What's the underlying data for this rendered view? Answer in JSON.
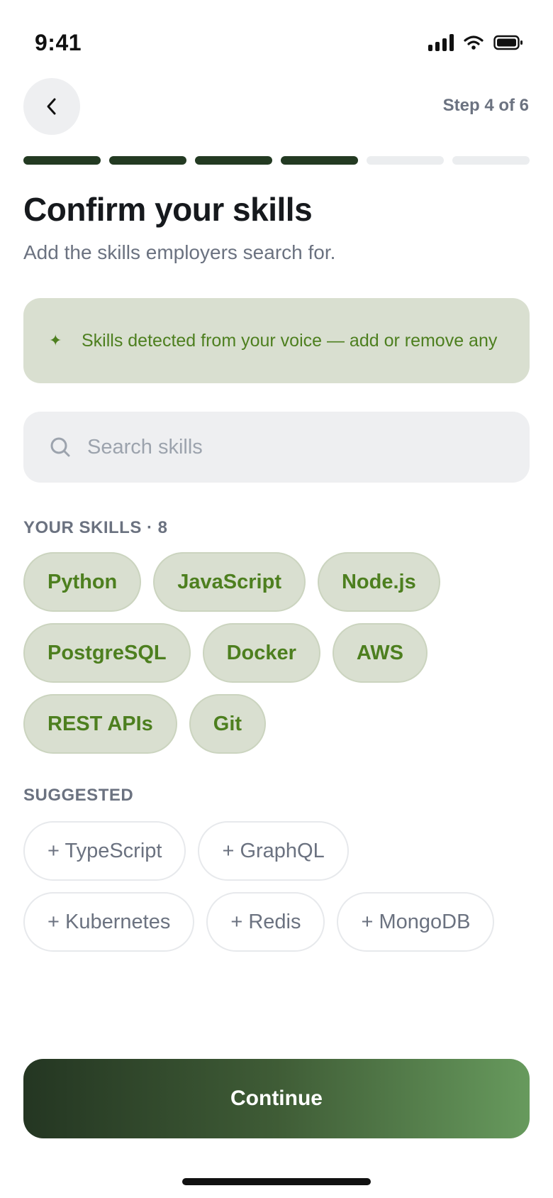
{
  "status_bar": {
    "time": "9:41"
  },
  "header": {
    "step": "Step 4 of 6"
  },
  "progress": {
    "completed": 4,
    "total": 6
  },
  "page": {
    "title": "Confirm your skills",
    "subtitle": "Add the skills employers search for."
  },
  "banner": {
    "icon": "sparkle-icon",
    "text": "Skills detected from your voice — add or remove any"
  },
  "search": {
    "placeholder": "Search skills",
    "value": ""
  },
  "your_skills": {
    "label": "YOUR SKILLS · 8",
    "items": [
      "Python",
      "JavaScript",
      "Node.js",
      "PostgreSQL",
      "Docker",
      "AWS",
      "REST APIs",
      "Git"
    ]
  },
  "suggested": {
    "label": "SUGGESTED",
    "items": [
      "+ TypeScript",
      "+ GraphQL",
      "+ Kubernetes",
      "+ Redis",
      "+ MongoDB"
    ]
  },
  "footer": {
    "continue_label": "Continue"
  },
  "colors": {
    "accent_dark": "#233a22",
    "accent_green": "#4d7f1f",
    "chip_bg": "#d9dfd0",
    "muted": "#6b7280"
  }
}
